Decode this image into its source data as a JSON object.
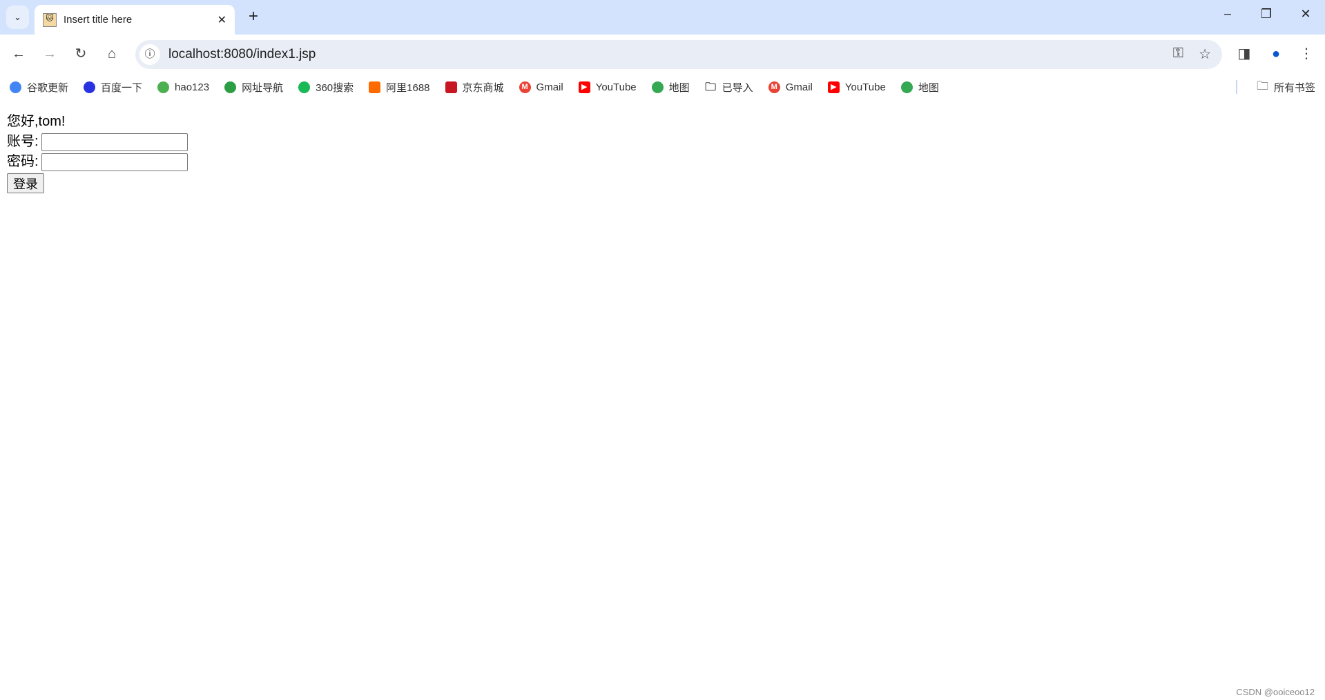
{
  "browser": {
    "tab_title": "Insert title here",
    "url": "localhost:8080/index1.jsp"
  },
  "bookmarks": [
    {
      "label": "谷歌更新",
      "icon": "chrome-icon",
      "color": "#4285f4"
    },
    {
      "label": "百度一下",
      "icon": "baidu-icon",
      "color": "#2932e1"
    },
    {
      "label": "hao123",
      "icon": "hao123-icon",
      "color": "#4caf50"
    },
    {
      "label": "网址导航",
      "icon": "2345-icon",
      "color": "#2e9e45"
    },
    {
      "label": "360搜索",
      "icon": "360-icon",
      "color": "#19b955"
    },
    {
      "label": "阿里1688",
      "icon": "1688-icon",
      "color": "#ff6a00"
    },
    {
      "label": "京东商城",
      "icon": "jd-icon",
      "color": "#c91623"
    },
    {
      "label": "Gmail",
      "icon": "gmail-icon",
      "color": "#ea4335"
    },
    {
      "label": "YouTube",
      "icon": "youtube-icon",
      "color": "#ff0000"
    },
    {
      "label": "地图",
      "icon": "maps-icon",
      "color": "#34a853"
    },
    {
      "label": "已导入",
      "icon": "folder-icon",
      "color": "#444444"
    },
    {
      "label": "Gmail",
      "icon": "gmail-icon",
      "color": "#ea4335"
    },
    {
      "label": "YouTube",
      "icon": "youtube-icon",
      "color": "#ff0000"
    },
    {
      "label": "地图",
      "icon": "maps-icon",
      "color": "#34a853"
    }
  ],
  "all_bookmarks": "所有书签",
  "page": {
    "greeting": "您好,tom!",
    "account_label": "账号:",
    "account_value": "",
    "password_label": "密码:",
    "password_value": "",
    "login_button": "登录"
  },
  "watermark": "CSDN @ooiceoo12"
}
